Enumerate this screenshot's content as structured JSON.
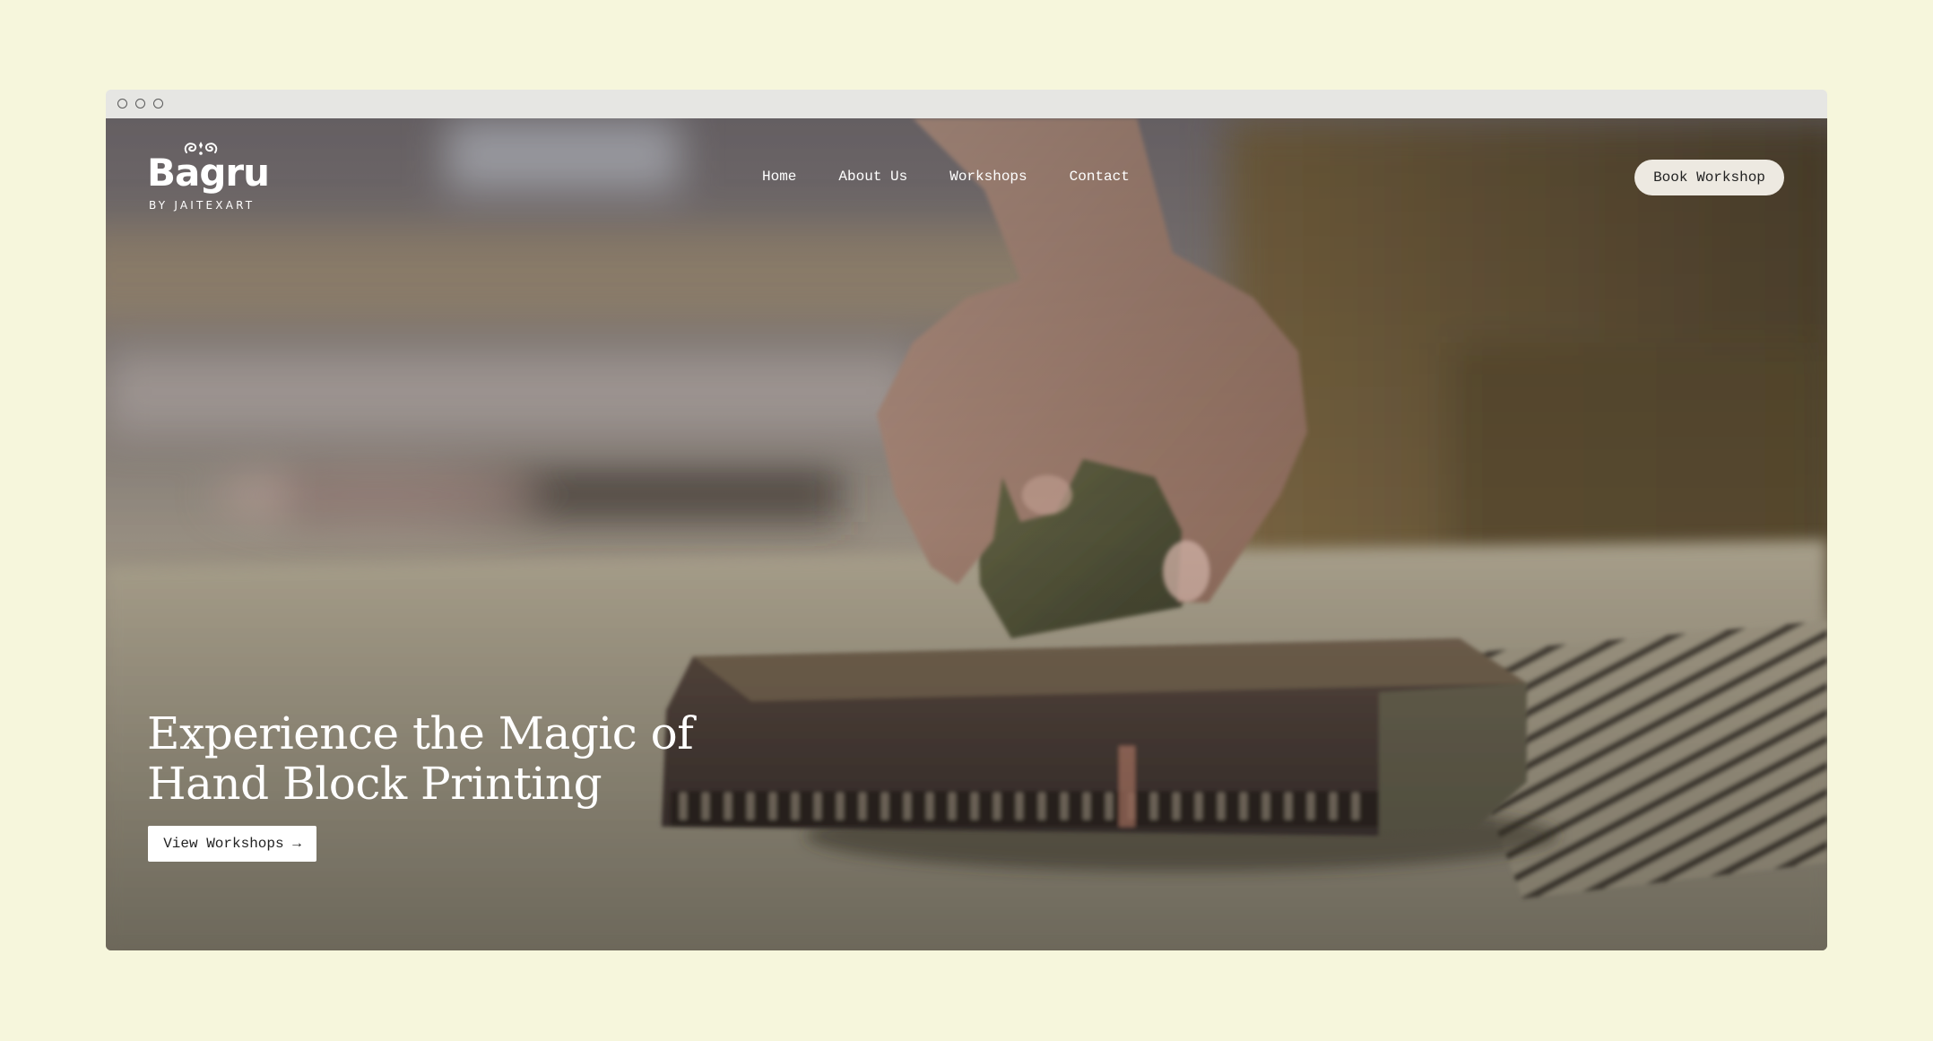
{
  "brand": {
    "name": "Bagru",
    "tagline": "BY JAITEXART"
  },
  "nav": {
    "items": [
      {
        "label": "Home"
      },
      {
        "label": "About Us"
      },
      {
        "label": "Workshops"
      },
      {
        "label": "Contact"
      }
    ],
    "cta_label": "Book Workshop"
  },
  "hero": {
    "title_line1": "Experience the Magic of",
    "title_line2": "Hand Block Printing",
    "cta_label": "View Workshops →",
    "background_image": "hand-block-printing-photo"
  },
  "colors": {
    "page_background": "#f6f6dc",
    "window_chrome": "#e6e6e3",
    "book_button": "#ede9e1",
    "text_on_hero": "#ffffff"
  }
}
